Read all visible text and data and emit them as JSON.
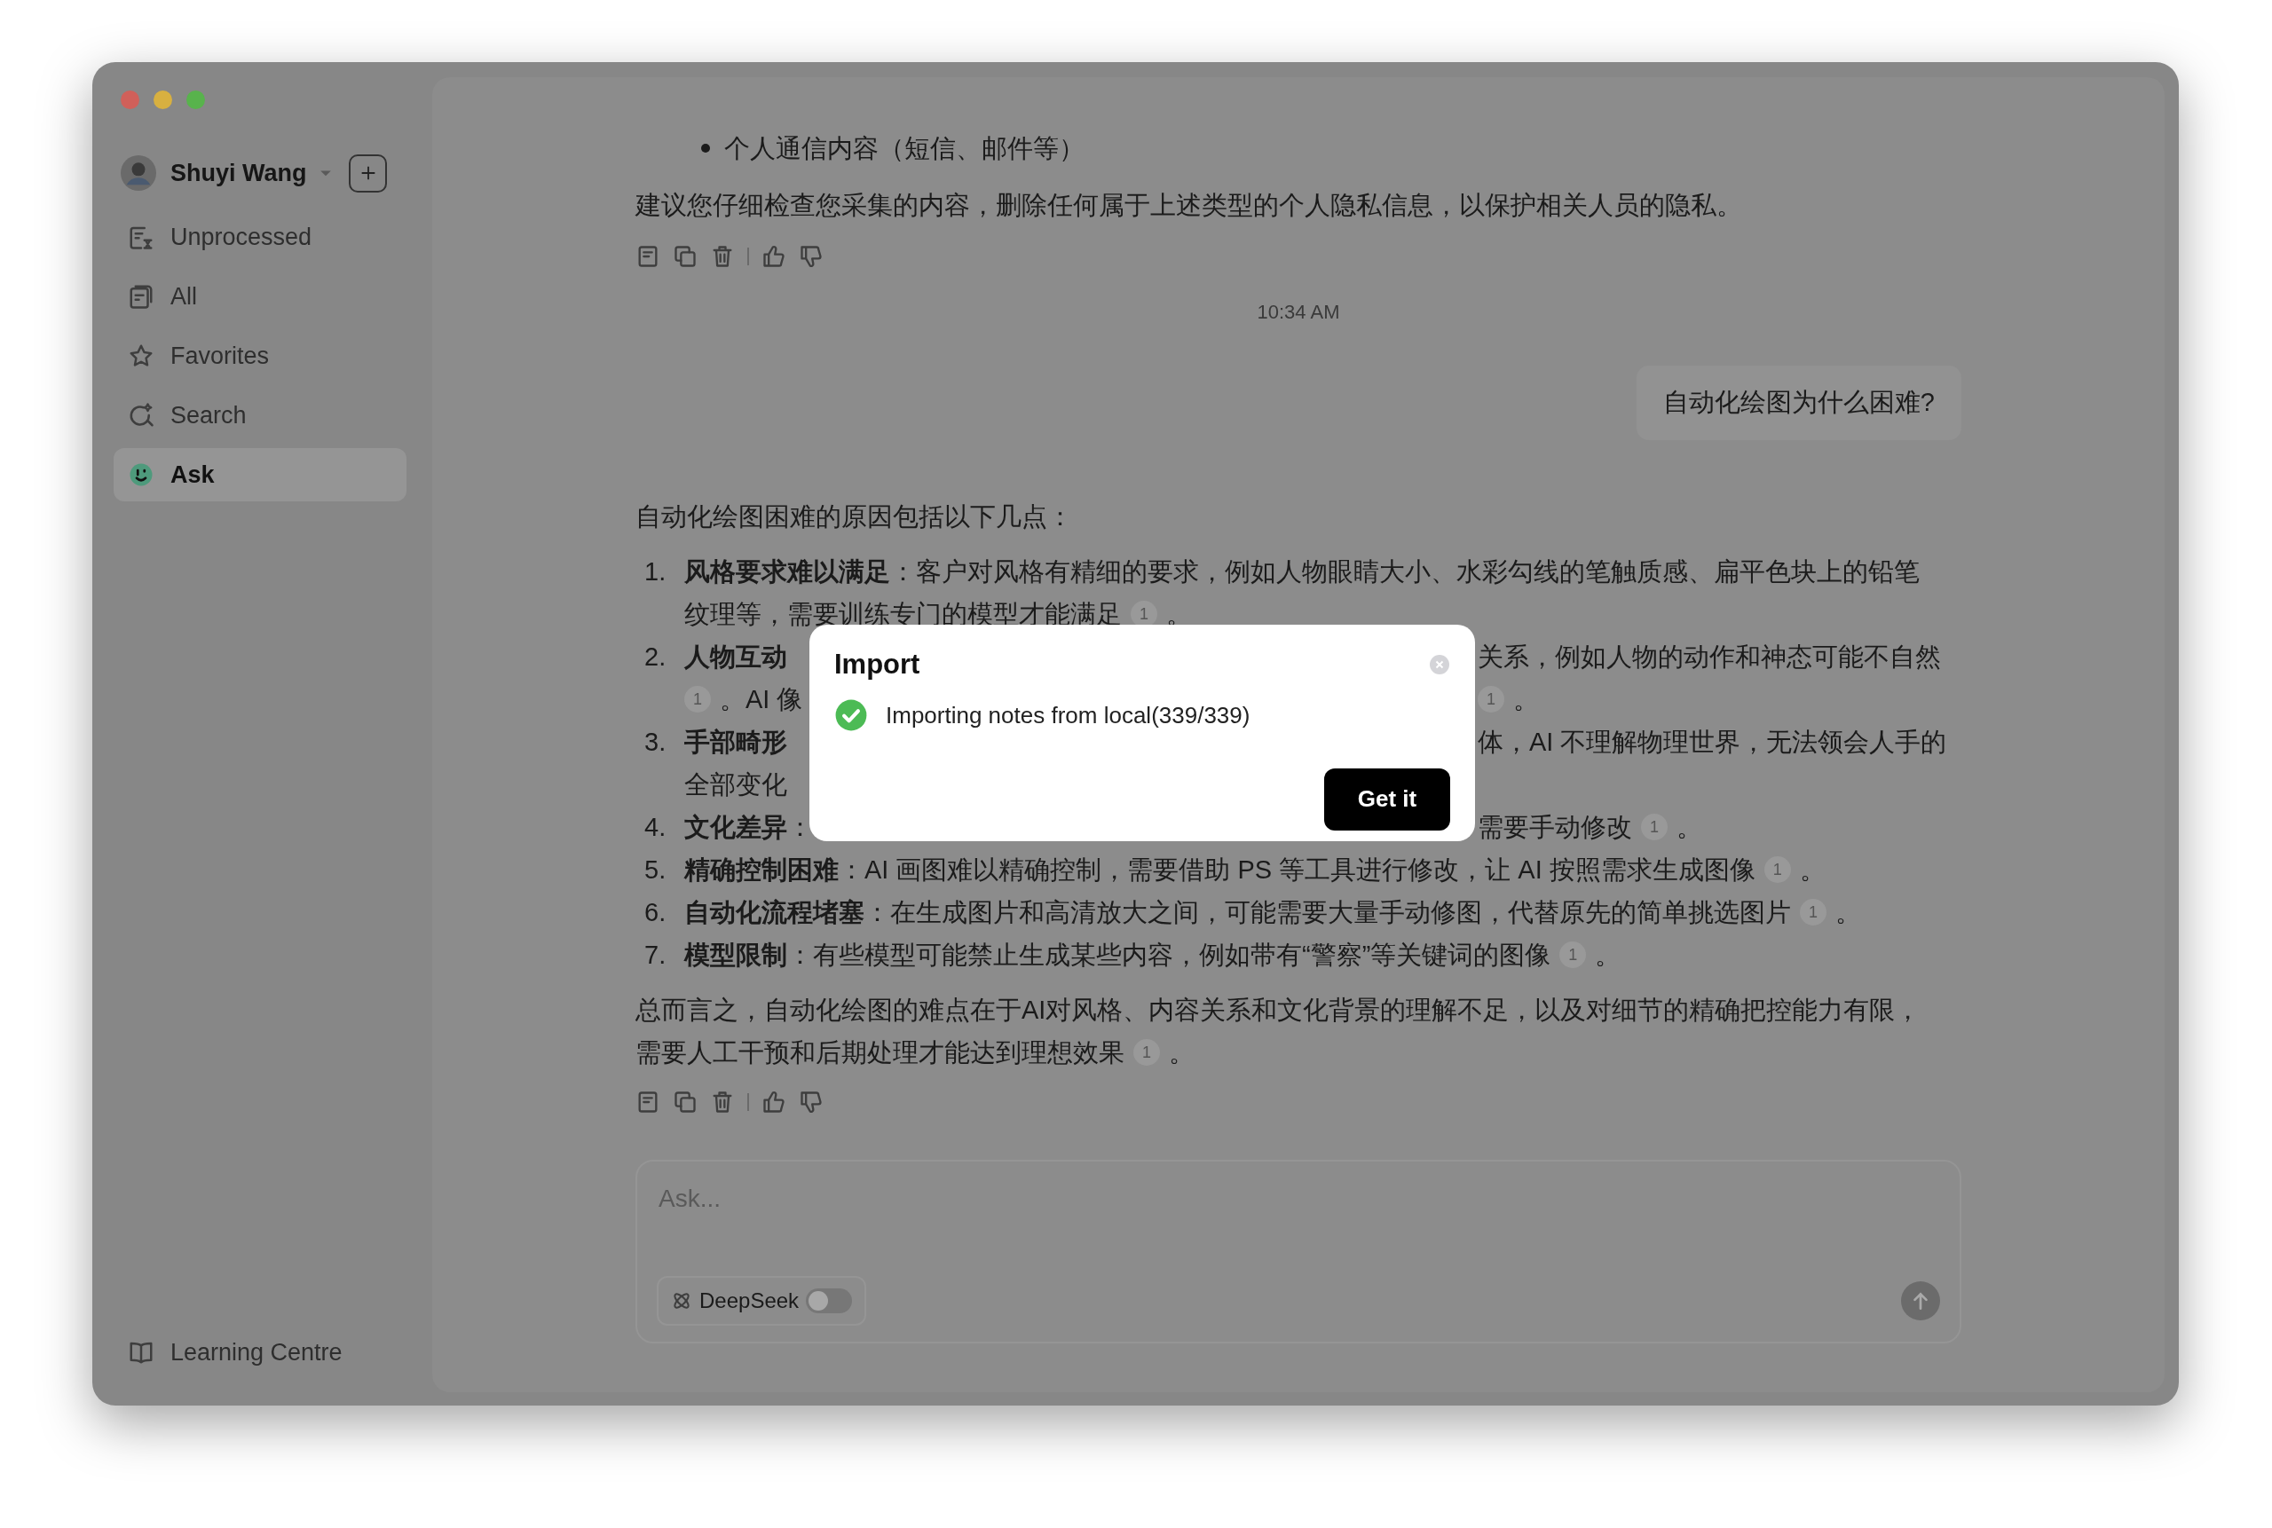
{
  "sidebar": {
    "user": {
      "name": "Shuyi Wang"
    },
    "items": [
      {
        "label": "Unprocessed",
        "selected": false
      },
      {
        "label": "All",
        "selected": false
      },
      {
        "label": "Favorites",
        "selected": false
      },
      {
        "label": "Search",
        "selected": false
      },
      {
        "label": "Ask",
        "selected": true
      }
    ],
    "footer_link": "Learning Centre"
  },
  "chat": {
    "bullets": [
      "个人通信内容（短信、邮件等）"
    ],
    "advice": "建议您仔细检查您采集的内容，删除任何属于上述类型的个人隐私信息，以保护相关人员的隐私。",
    "timestamp": "10:34 AM",
    "user_message": "自动化绘图为什么困难?",
    "answer_intro": "自动化绘图困难的原因包括以下几点：",
    "list": [
      {
        "number": "1.",
        "lines": [
          {
            "left": [
              {
                "kind": "bold",
                "text": "风格要求难以满足"
              },
              {
                "kind": "text",
                "text": "：客户对风格有精细的要求，例如人物眼睛大小、水彩勾线的笔触质感、扁平色块上的铅笔"
              }
            ]
          },
          {
            "left": [
              {
                "kind": "text",
                "text": "纹理等，需要训练专门的模型才能满足"
              },
              {
                "kind": "cite",
                "text": "1"
              },
              {
                "kind": "text",
                "text": "。"
              }
            ]
          }
        ]
      },
      {
        "number": "2.",
        "lines": [
          {
            "left": [
              {
                "kind": "bold",
                "text": "人物互动"
              }
            ],
            "right": [
              {
                "kind": "text",
                "text": "关系，例如人物的动作和神态可能不自然"
              }
            ]
          },
          {
            "left": [
              {
                "kind": "cite",
                "text": "1"
              },
              {
                "kind": "text",
                "text": "。AI 像"
              }
            ],
            "right": [
              {
                "kind": "cite",
                "text": "1"
              },
              {
                "kind": "text",
                "text": "。"
              }
            ]
          }
        ]
      },
      {
        "number": "3.",
        "lines": [
          {
            "left": [
              {
                "kind": "bold",
                "text": "手部畸形"
              }
            ],
            "right": [
              {
                "kind": "text",
                "text": "体，AI 不理解物理世界，无法领会人手的"
              }
            ]
          },
          {
            "left": [
              {
                "kind": "text",
                "text": "全部变化"
              }
            ]
          }
        ]
      },
      {
        "number": "4.",
        "lines": [
          {
            "left": [
              {
                "kind": "bold",
                "text": "文化差异"
              },
              {
                "kind": "text",
                "text": "："
              }
            ],
            "right": [
              {
                "kind": "text",
                "text": "需要手动修改"
              },
              {
                "kind": "cite",
                "text": "1"
              },
              {
                "kind": "text",
                "text": "。"
              }
            ]
          }
        ]
      },
      {
        "number": "5.",
        "lines": [
          {
            "left": [
              {
                "kind": "bold",
                "text": "精确控制困难"
              },
              {
                "kind": "text",
                "text": "：AI 画图难以精确控制，需要借助 PS 等工具进行修改，让 AI 按照需求生成图像"
              },
              {
                "kind": "cite",
                "text": "1"
              },
              {
                "kind": "text",
                "text": "。"
              }
            ]
          }
        ]
      },
      {
        "number": "6.",
        "lines": [
          {
            "left": [
              {
                "kind": "bold",
                "text": "自动化流程堵塞"
              },
              {
                "kind": "text",
                "text": "：在生成图片和高清放大之间，可能需要大量手动修图，代替原先的简单挑选图片"
              },
              {
                "kind": "cite",
                "text": "1"
              },
              {
                "kind": "text",
                "text": "。"
              }
            ]
          }
        ]
      },
      {
        "number": "7.",
        "lines": [
          {
            "left": [
              {
                "kind": "bold",
                "text": "模型限制"
              },
              {
                "kind": "text",
                "text": "：有些模型可能禁止生成某些内容，例如带有“警察”等关键词的图像"
              },
              {
                "kind": "cite",
                "text": "1"
              },
              {
                "kind": "text",
                "text": "。"
              }
            ]
          }
        ]
      }
    ],
    "summary": [
      {
        "kind": "text",
        "text": "总而言之，自动化绘图的难点在于AI对风格、内容关系和文化背景的理解不足，以及对细节的精确把控能力有限，"
      },
      {
        "kind": "break"
      },
      {
        "kind": "text",
        "text": "需要人工干预和后期处理才能达到理想效果"
      },
      {
        "kind": "cite",
        "text": "1"
      },
      {
        "kind": "text",
        "text": "。"
      }
    ]
  },
  "composer": {
    "placeholder": "Ask...",
    "model": {
      "label": "DeepSeek",
      "on": false
    }
  },
  "dialog": {
    "title": "Import",
    "message": "Importing notes from local(339/339)",
    "button": "Get it"
  }
}
